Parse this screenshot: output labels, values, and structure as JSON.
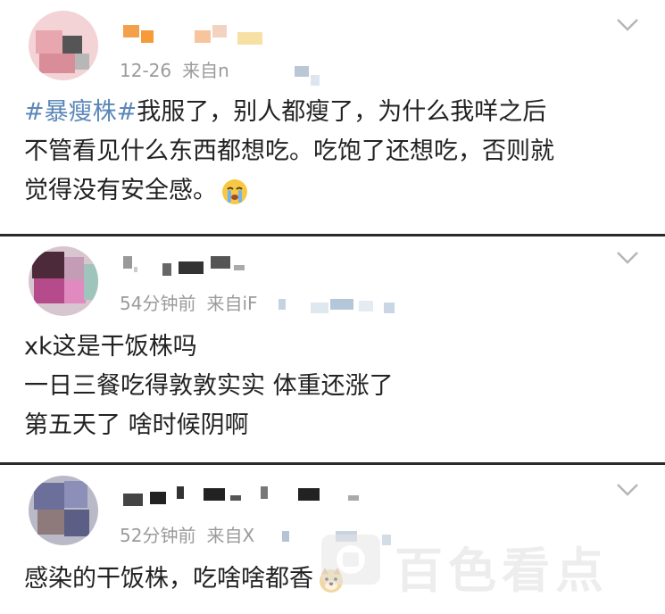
{
  "posts": [
    {
      "timestamp": "12-26",
      "source": "来自",
      "source_partial": "n",
      "hashtag": "#暴瘦株#",
      "lines": [
        "我服了，别人都瘦了，为什么我咩之后",
        "不管看见什么东西都想吃。吃饱了还想吃，否则就",
        "觉得没有安全感。"
      ],
      "emoji": "crying-face-icon"
    },
    {
      "timestamp": "54分钟前",
      "source": "来自",
      "source_partial": "iF",
      "lines": [
        "xk这是干饭株吗",
        "一日三餐吃得敦敦实实 体重还涨了",
        "第五天了 啥时候阴啊"
      ]
    },
    {
      "timestamp": "52分钟前",
      "source": "来自",
      "source_partial": "X",
      "lines": [
        "感染的干饭株，吃啥啥都香"
      ],
      "emoji": "doge-icon"
    }
  ],
  "watermark": {
    "text": "百色看点"
  },
  "colors": {
    "hashtag": "#5b87b8",
    "meta": "#9b9b9b",
    "divider": "#2a2a2a"
  }
}
